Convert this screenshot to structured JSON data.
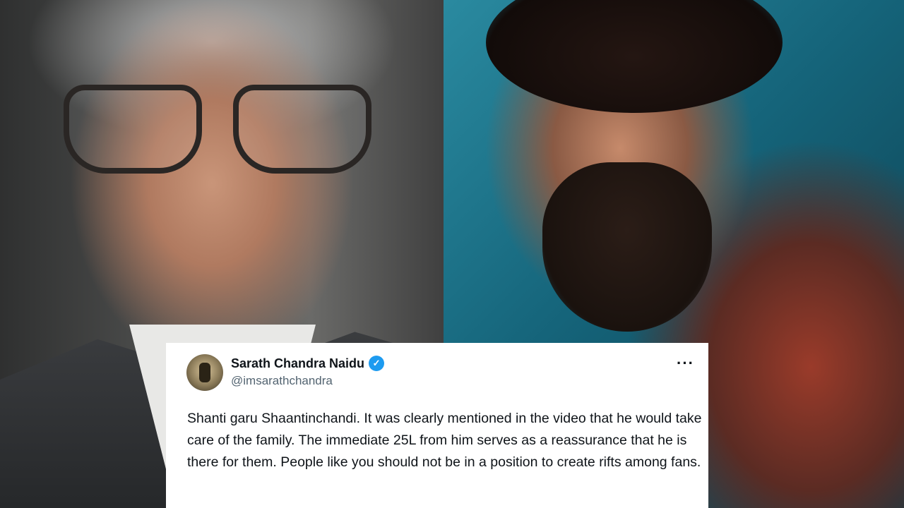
{
  "tweet": {
    "name": "Sarath Chandra Naidu",
    "handle": "@imsarathchandra",
    "verified_glyph": "✓",
    "more_glyph": "···",
    "text": "Shanti garu Shaantinchandi. It was clearly mentioned in the video that he would take care of the family. The immediate 25L from him serves as a reassurance that he is there for them. People like you should not be in a position to create rifts among fans."
  },
  "icons": {
    "verified": "verified-badge-icon",
    "more": "more-options-icon"
  },
  "colors": {
    "verified": "#1d9bf0",
    "text": "#0f1419",
    "handle": "#536471"
  }
}
